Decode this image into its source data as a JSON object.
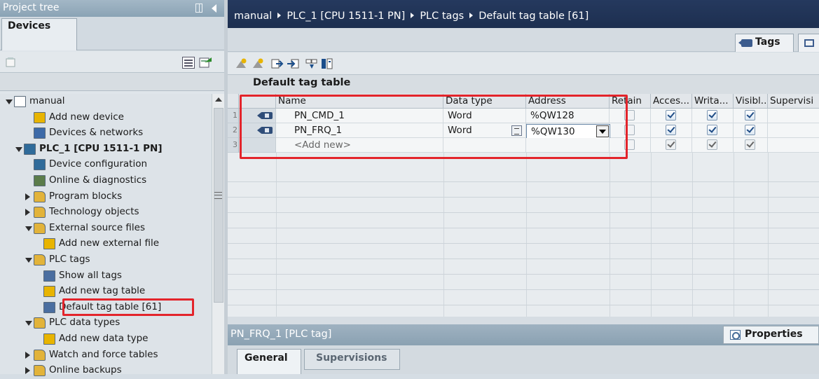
{
  "tree": {
    "title": "Project tree",
    "tab": "Devices",
    "items": [
      {
        "label": "manual",
        "icon": "project-icon",
        "expand": "down"
      },
      {
        "label": "Add new device",
        "icon": "add-device-icon",
        "expand": ""
      },
      {
        "label": "Devices & networks",
        "icon": "network-icon",
        "expand": ""
      },
      {
        "label": "PLC_1 [CPU 1511-1 PN]",
        "icon": "plc-icon",
        "expand": "down"
      },
      {
        "label": "Device configuration",
        "icon": "device-config-icon",
        "expand": ""
      },
      {
        "label": "Online & diagnostics",
        "icon": "online-diag-icon",
        "expand": ""
      },
      {
        "label": "Program blocks",
        "icon": "folder-icon",
        "expand": "right"
      },
      {
        "label": "Technology objects",
        "icon": "folder-icon",
        "expand": "right"
      },
      {
        "label": "External source files",
        "icon": "folder-icon",
        "expand": "down"
      },
      {
        "label": "Add new external file",
        "icon": "add-file-icon",
        "expand": ""
      },
      {
        "label": "PLC tags",
        "icon": "folder-icon",
        "expand": "down"
      },
      {
        "label": "Show all tags",
        "icon": "tags-icon",
        "expand": ""
      },
      {
        "label": "Add new tag table",
        "icon": "add-table-icon",
        "expand": ""
      },
      {
        "label": "Default tag table [61]",
        "icon": "tag-table-icon",
        "expand": ""
      },
      {
        "label": "PLC data types",
        "icon": "folder-icon",
        "expand": "down"
      },
      {
        "label": "Add new data type",
        "icon": "add-type-icon",
        "expand": ""
      },
      {
        "label": "Watch and force tables",
        "icon": "folder-icon",
        "expand": "right"
      },
      {
        "label": "Online backups",
        "icon": "folder-icon",
        "expand": "right"
      }
    ]
  },
  "breadcrumb": [
    "manual",
    "PLC_1 [CPU 1511-1 PN]",
    "PLC tags",
    "Default tag table [61]"
  ],
  "tags_tab": "Tags",
  "table": {
    "title": "Default tag table",
    "headers": [
      "Name",
      "Data type",
      "Address",
      "Retain",
      "Acces...",
      "Writa...",
      "Visibl...",
      "Supervisi"
    ],
    "rows": [
      {
        "num": "1",
        "name": "PN_CMD_1",
        "datatype": "Word",
        "address": "%QW128"
      },
      {
        "num": "2",
        "name": "PN_FRQ_1",
        "datatype": "Word",
        "address": "%QW130"
      },
      {
        "num": "3",
        "name": "<Add new>",
        "datatype": "",
        "address": ""
      }
    ]
  },
  "properties": {
    "title": "PN_FRQ_1 [PLC tag]",
    "button": "Properties",
    "tabs": [
      "General",
      "Supervisions"
    ]
  },
  "colors": {
    "breadcrumb_bg": "#1f3256",
    "highlight": "#e3242b",
    "tag_icon": "#2f4d79"
  }
}
